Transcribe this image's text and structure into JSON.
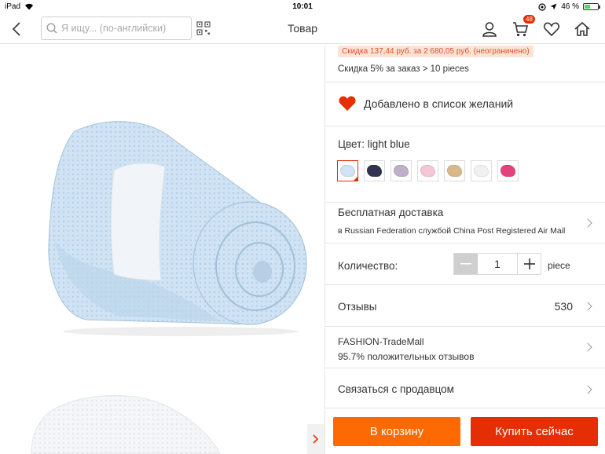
{
  "status_bar": {
    "device": "iPad",
    "time": "10:01",
    "battery": "46 %",
    "battery_level": 0.46
  },
  "nav": {
    "search_placeholder": "Я ищу... (по-английски)",
    "title": "Товар",
    "cart_count": "48",
    "icons": [
      "back-chevron-icon",
      "search-icon",
      "qr-scan-icon",
      "user-icon",
      "cart-icon",
      "heart-icon",
      "home-icon"
    ]
  },
  "product": {
    "discount_tag": "Скидка 137,44 руб. за 2 680,05 руб. (неограничено)",
    "discount_line": "Скидка 5% за заказ > 10 pieces",
    "wishlist_label": "Добавлено в список желаний",
    "color_label": "Цвет: light blue",
    "swatches": [
      {
        "color": "#cfe3f4",
        "selected": true
      },
      {
        "color": "#2f3550",
        "selected": false
      },
      {
        "color": "#bfb0c9",
        "selected": false
      },
      {
        "color": "#f4c7d6",
        "selected": false
      },
      {
        "color": "#d8b98a",
        "selected": false
      },
      {
        "color": "#f1f1f1",
        "selected": false
      },
      {
        "color": "#e4427b",
        "selected": false
      }
    ],
    "shipping_title": "Бесплатная доставка",
    "shipping_sub": "в Russian Federation службой China Post Registered Air Mail",
    "quantity_label": "Количество:",
    "quantity_value": "1",
    "quantity_unit": "piece",
    "reviews_label": "Отзывы",
    "reviews_count": "530",
    "store_name": "FASHION-TradeMall",
    "store_rating": "95.7% положительных отзывов",
    "contact_label": "Связаться с продавцом"
  },
  "buttons": {
    "add_to_cart": "В корзину",
    "buy_now": "Купить сейчас"
  },
  "colors": {
    "accent_orange": "#ff6a00",
    "accent_red": "#e62e04",
    "blanket": "#cfe3f4"
  }
}
